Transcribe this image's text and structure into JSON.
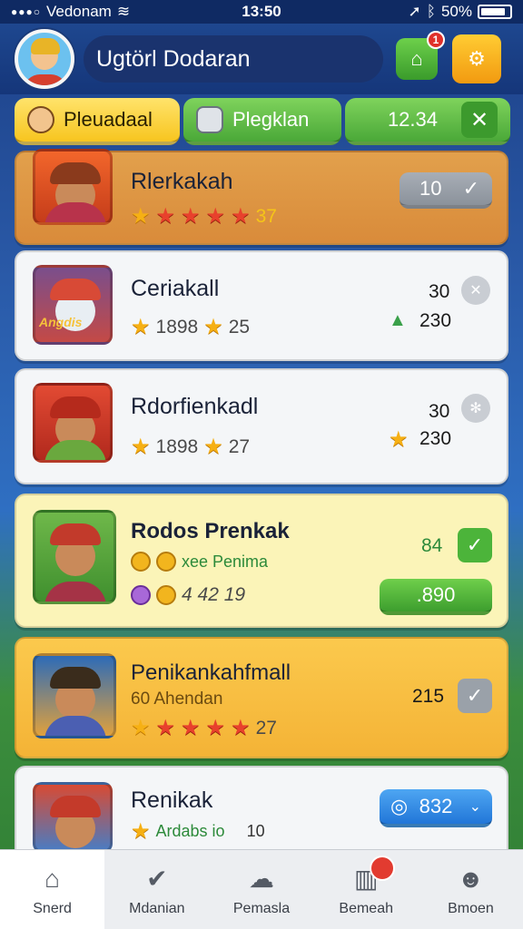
{
  "status_bar": {
    "carrier": "Vedonam",
    "time": "13:50",
    "battery": "50%"
  },
  "header": {
    "title": "Ugtörl Dodaran",
    "notification_count": "1"
  },
  "tabs": [
    {
      "label": "Pleuadaal"
    },
    {
      "label": "Plegklan"
    },
    {
      "label": "12.34"
    }
  ],
  "cards": [
    {
      "name": "Rlerkakah",
      "rating_value": "37",
      "button": "10"
    },
    {
      "name": "Ceriakall",
      "sub_value_1": "1898",
      "sub_value_2": "25",
      "thumb_text": "Angdis",
      "right_top": "30",
      "right_bottom": "230"
    },
    {
      "name": "Rdorfienkadl",
      "sub_value_1": "1898",
      "sub_value_2": "27",
      "right_top": "30",
      "right_bottom": "230"
    },
    {
      "name": "Rodos Prenkak",
      "sub_text": "xee Penima",
      "sub_values": "4 42 19",
      "right_top": "84",
      "button": ".890"
    },
    {
      "name": "Penikankahfmall",
      "sub_text": "60 Ahendan",
      "rating_value": "27",
      "right_top": "215"
    },
    {
      "name": "Renikak",
      "sub_text": "Ardabs io",
      "sub_value": "10",
      "button": "832"
    }
  ],
  "bottom_nav": [
    {
      "label": "Snerd",
      "icon": "home-icon"
    },
    {
      "label": "Mdanian",
      "icon": "shield-check-icon"
    },
    {
      "label": "Pemasla",
      "icon": "chat-icon"
    },
    {
      "label": "Bemeah",
      "icon": "bars-icon"
    },
    {
      "label": "Bmoen",
      "icon": "person-icon"
    }
  ],
  "colors": {
    "accent_yellow": "#f7c51f",
    "accent_green": "#4aa838",
    "header_blue": "#15367a"
  }
}
